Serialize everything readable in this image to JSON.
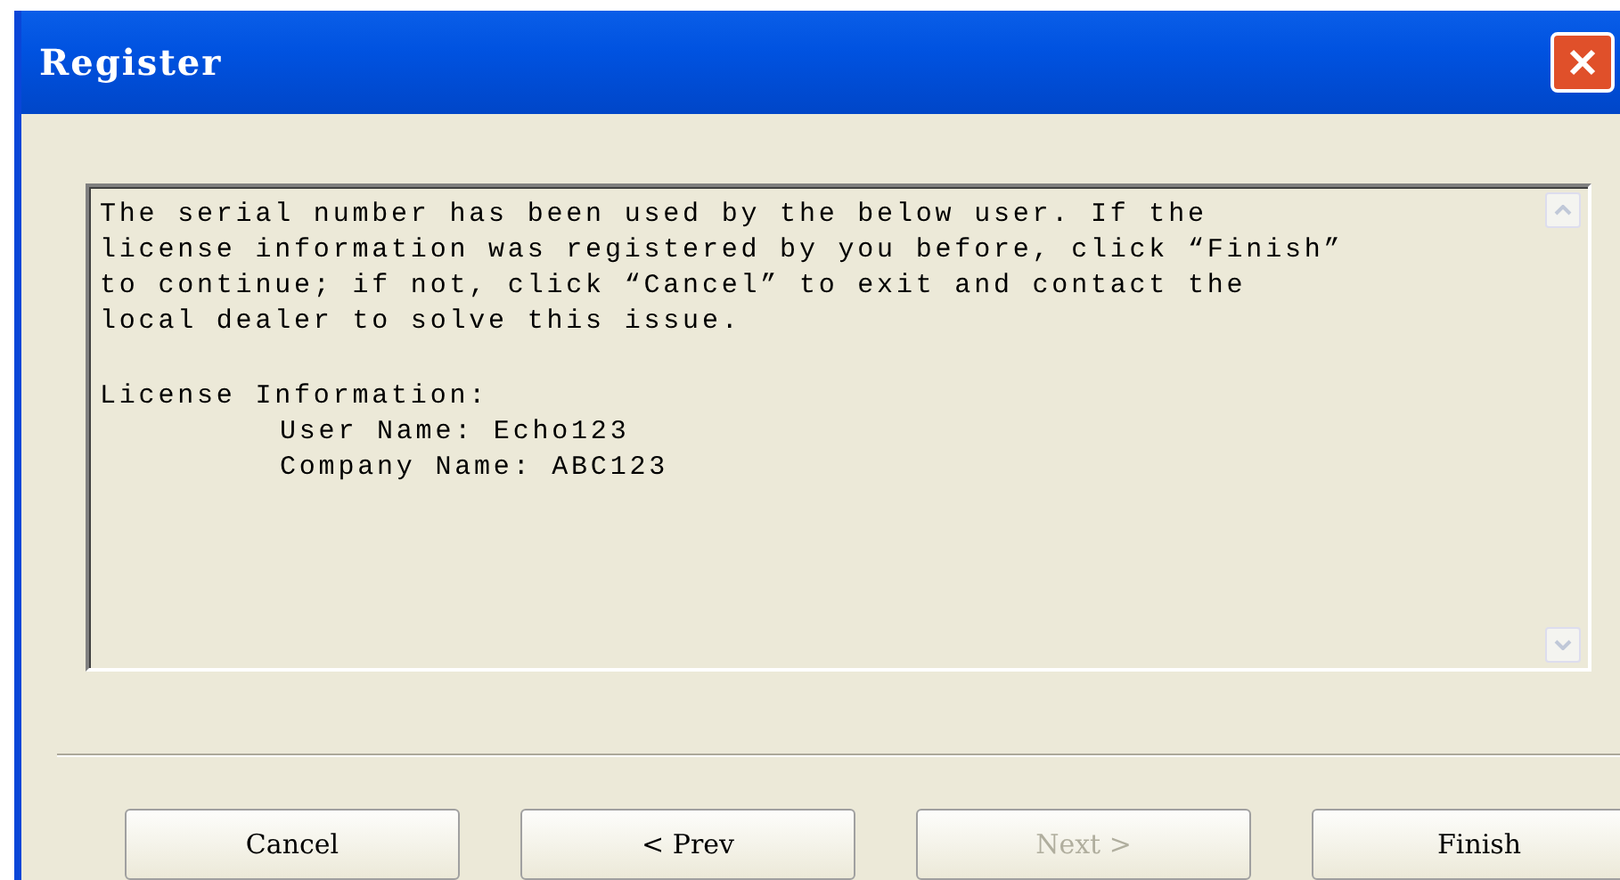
{
  "window": {
    "title": "Register"
  },
  "message": {
    "lines": [
      "The serial number has been used by the below user. If the",
      "license information was registered by you before, click “Finish”",
      "to continue; if not, click “Cancel” to exit and contact the",
      "local dealer to solve this issue."
    ],
    "license_heading": "License Information:",
    "license_fields": [
      "User Name: Echo123",
      "Company Name: ABC123"
    ]
  },
  "buttons": [
    {
      "label": "Cancel",
      "disabled": false
    },
    {
      "label": "< Prev",
      "disabled": false
    },
    {
      "label": "Next >",
      "disabled": true
    },
    {
      "label": "Finish",
      "disabled": false
    }
  ]
}
